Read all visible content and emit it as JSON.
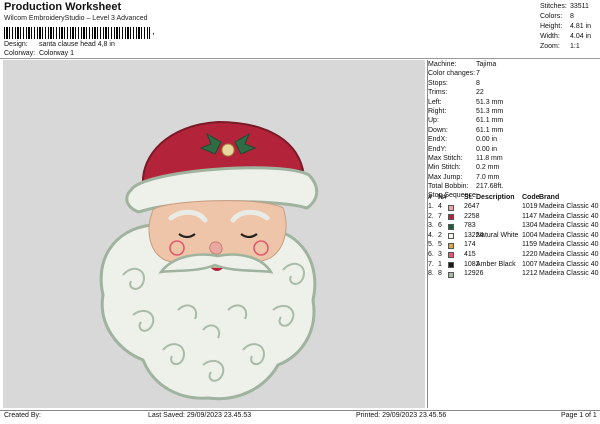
{
  "header": {
    "title": "Production Worksheet",
    "subtitle": "Wilcom EmbroideryStudio – Level 3 Advanced",
    "barcode_tail": ",",
    "design_label": "Design:",
    "design_value": "santa clause head 4,8 in",
    "colorway_label": "Colorway:",
    "colorway_value": "Colorway 1"
  },
  "stats": [
    {
      "label": "Stitches:",
      "value": "33511"
    },
    {
      "label": "Colors:",
      "value": "8"
    },
    {
      "label": "Height:",
      "value": "4.81 in"
    },
    {
      "label": "Width:",
      "value": "4.04 in"
    },
    {
      "label": "Zoom:",
      "value": "1:1"
    }
  ],
  "machine_info": [
    {
      "label": "Machine:",
      "value": "Tajima"
    },
    {
      "label": "Color changes:",
      "value": "7"
    },
    {
      "label": "Stops:",
      "value": "8"
    },
    {
      "label": "Trims:",
      "value": "22"
    },
    {
      "label": "Left:",
      "value": "51.3 mm"
    },
    {
      "label": "Right:",
      "value": "51.3 mm"
    },
    {
      "label": "Up:",
      "value": "61.1 mm"
    },
    {
      "label": "Down:",
      "value": "61.1 mm"
    },
    {
      "label": "EndX:",
      "value": "0.00 in"
    },
    {
      "label": "EndY:",
      "value": "0.00 in"
    },
    {
      "label": "Max Stitch:",
      "value": "11.8 mm"
    },
    {
      "label": "Min Stitch:",
      "value": "0.2 mm"
    },
    {
      "label": "Max Jump:",
      "value": "7.0 mm"
    },
    {
      "label": "Total Bobbin:",
      "value": "217.68ft."
    }
  ],
  "stop_sequence": {
    "title": "Stop Sequence:",
    "headers": {
      "num": "#",
      "n": "N#",
      "st": "St.",
      "description": "Description",
      "code": "Code",
      "brand": "Brand"
    },
    "rows": [
      {
        "num": "1.",
        "n": "4",
        "color": "#e8a8a0",
        "st": "2647",
        "description": "",
        "code": "1019",
        "brand": "Madeira Classic 40"
      },
      {
        "num": "2.",
        "n": "7",
        "color": "#b3243a",
        "st": "2258",
        "description": "",
        "code": "1147",
        "brand": "Madeira Classic 40"
      },
      {
        "num": "3.",
        "n": "6",
        "color": "#1f5e3a",
        "st": "783",
        "description": "",
        "code": "1304",
        "brand": "Madeira Classic 40"
      },
      {
        "num": "4.",
        "n": "2",
        "color": "#f4f4ee",
        "st": "13224",
        "description": "Natural White",
        "code": "1004",
        "brand": "Madeira Classic 40"
      },
      {
        "num": "5.",
        "n": "5",
        "color": "#d8a84a",
        "st": "174",
        "description": "",
        "code": "1159",
        "brand": "Madeira Classic 40"
      },
      {
        "num": "6.",
        "n": "3",
        "color": "#e05a70",
        "st": "415",
        "description": "",
        "code": "1220",
        "brand": "Madeira Classic 40"
      },
      {
        "num": "7.",
        "n": "1",
        "color": "#1a1a1a",
        "st": "1082",
        "description": "Amber Black",
        "code": "1007",
        "brand": "Madeira Classic 40"
      },
      {
        "num": "8.",
        "n": "8",
        "color": "#a8b8a6",
        "st": "12926",
        "description": "",
        "code": "1212",
        "brand": "Madeira Classic 40"
      }
    ]
  },
  "footer": {
    "created_by": "Created By:",
    "last_saved": "Last Saved: 29/09/2023 23.45.53",
    "printed": "Printed: 29/09/2023 23.45.56",
    "page": "Page 1 of 1"
  }
}
